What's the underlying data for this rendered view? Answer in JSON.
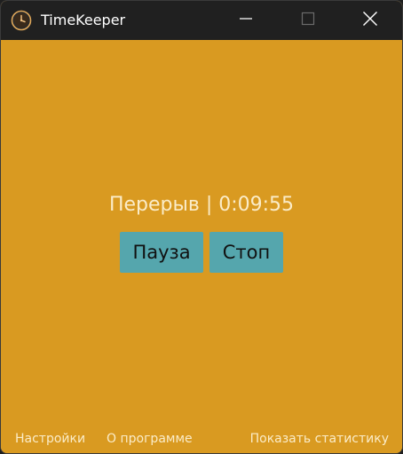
{
  "titlebar": {
    "title": "TimeKeeper",
    "app_icon": "clock-icon",
    "controls": {
      "minimize_icon": "minimize-icon",
      "maximize_icon": "maximize-icon",
      "close_icon": "close-icon"
    }
  },
  "main": {
    "status_text": "Перерыв | 0:09:55",
    "pause_label": "Пауза",
    "stop_label": "Стоп"
  },
  "footer": {
    "settings_label": "Настройки",
    "about_label": "О программе",
    "stats_label": "Показать статистику"
  },
  "colors": {
    "background": "#d99a21",
    "titlebar": "#202020",
    "button": "#55a6ad",
    "text_light": "#fbecc8"
  }
}
